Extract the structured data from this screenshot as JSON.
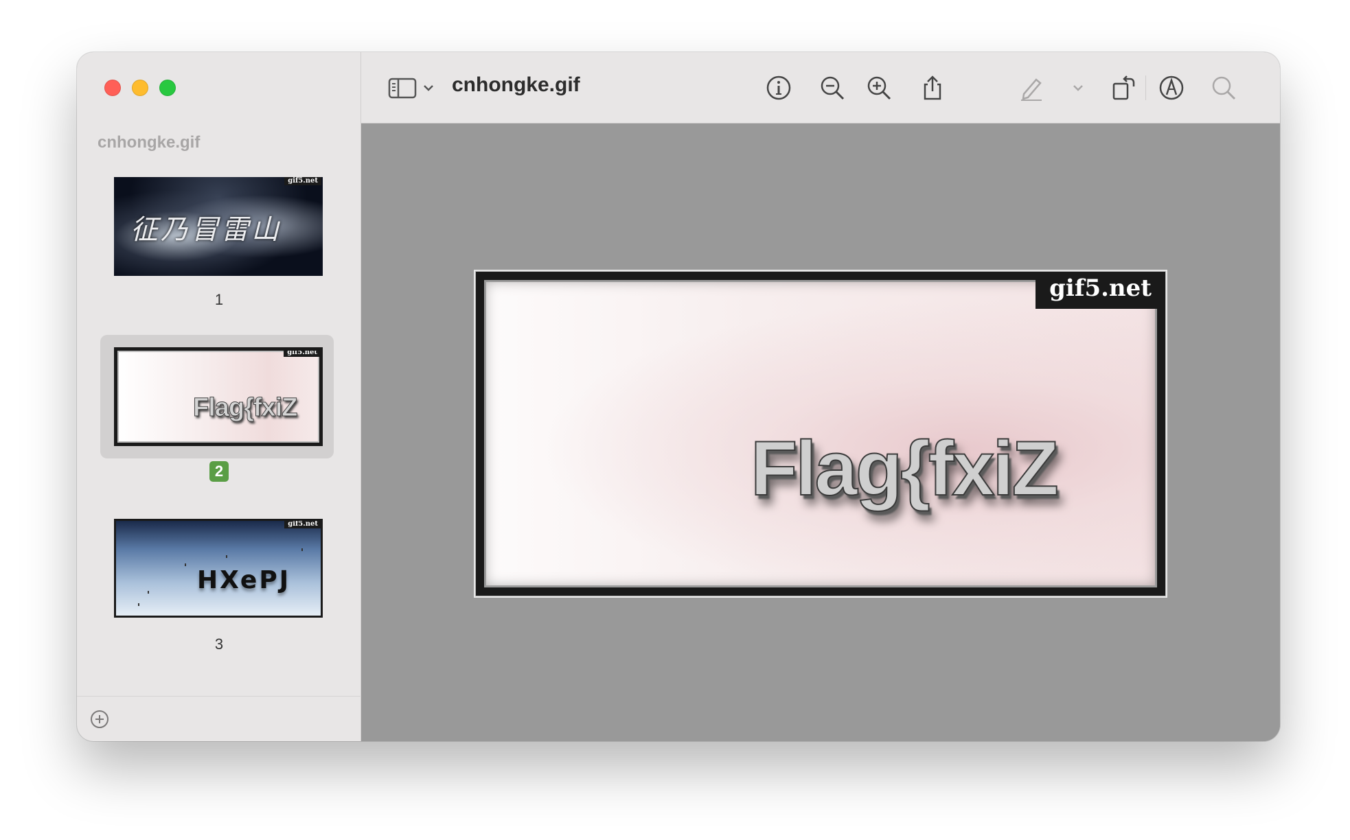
{
  "window": {
    "title": "cnhongke.gif"
  },
  "sidebar": {
    "heading": "cnhongke.gif",
    "pages": [
      {
        "number": "1",
        "watermark": "gif5.net",
        "selected": false
      },
      {
        "number": "2",
        "watermark": "gif5.net",
        "text": "Flag{fxiZ",
        "selected": true
      },
      {
        "number": "3",
        "watermark": "gif5.net",
        "text": "HXePJ",
        "selected": false
      }
    ]
  },
  "toolbar": {
    "icons": [
      "sidebar-toggle-icon",
      "chevron-down-icon",
      "info-icon",
      "zoom-out-icon",
      "zoom-in-icon",
      "share-icon",
      "highlight-pen-icon",
      "chevron-down-icon",
      "rotate-icon",
      "markup-icon",
      "search-icon"
    ]
  },
  "viewer": {
    "watermark": "gif5.net",
    "image_text": "Flag{fxiZ"
  },
  "colors": {
    "selected_badge": "#5a9e45",
    "sidebar_bg": "#e8e6e6",
    "canvas_bg": "#999999"
  }
}
